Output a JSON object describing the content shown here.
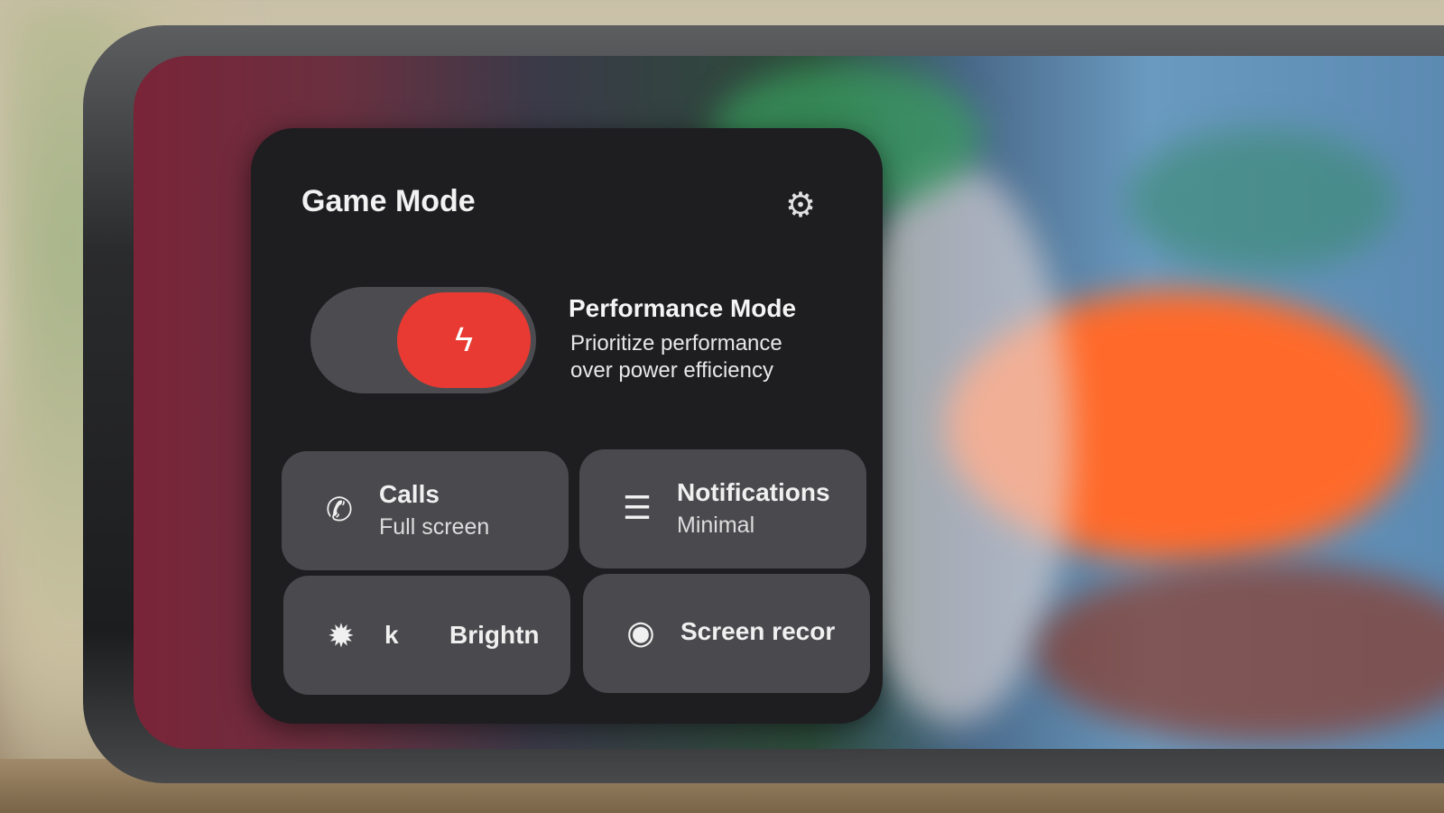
{
  "panel": {
    "title": "Game Mode",
    "settings_icon": "gear-icon",
    "performance": {
      "title": "Performance Mode",
      "description": "Prioritize performance over power efficiency",
      "enabled": true,
      "icon": "lightning-bolt-icon",
      "accent_color": "#e83a32"
    },
    "tiles": [
      {
        "title": "Calls",
        "subtitle": "Full screen",
        "icon": "phone-off-icon"
      },
      {
        "title": "Notifications",
        "subtitle": "Minimal",
        "icon": "notification-panel-icon"
      },
      {
        "title": "k",
        "title2": "Brightn",
        "icon": "brightness-lock-icon"
      },
      {
        "title": "Screen recor",
        "icon": "screen-record-icon"
      }
    ]
  }
}
